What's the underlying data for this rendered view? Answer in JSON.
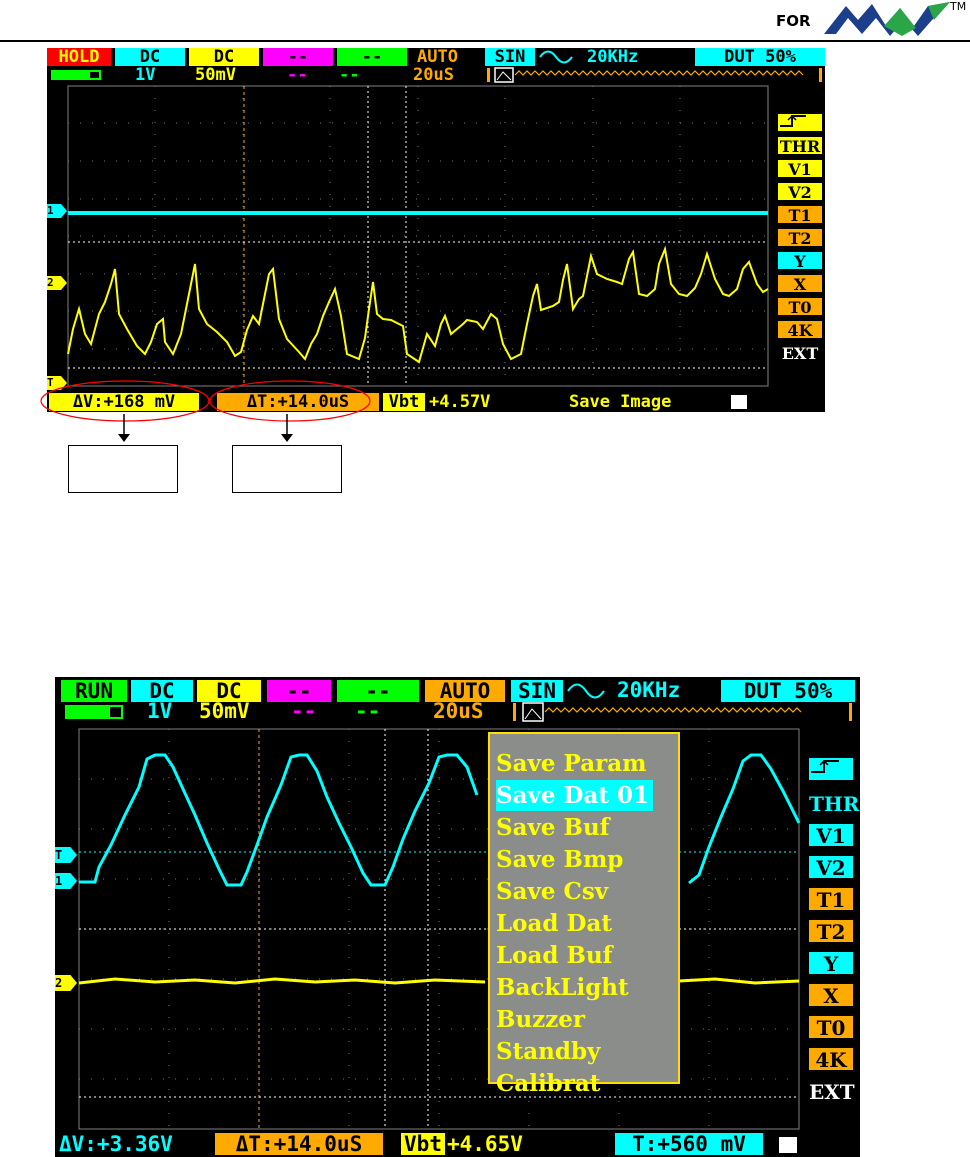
{
  "brand": {
    "for_label": "FOR",
    "tm": "TM"
  },
  "screen1": {
    "status": {
      "mode": "HOLD",
      "ch1_coupling": "DC",
      "ch2_coupling": "DC",
      "ch3": "--",
      "ch4": "--",
      "trigger_mode": "AUTO",
      "wave": "SIN",
      "freq": "20KHz",
      "duty": "DUT 50%"
    },
    "row2": {
      "ch1_scale": "1V",
      "ch2_scale": "50mV",
      "ch3_scale": "--",
      "ch4_scale": "--",
      "timebase": "20uS"
    },
    "side_menu": [
      "THR",
      "V1",
      "V2",
      "T1",
      "T2",
      "Y",
      "X",
      "T0",
      "4K",
      "EXT"
    ],
    "bottom": {
      "dv": "ΔV:+168 mV",
      "dt": "ΔT:+14.0uS",
      "vbt_label": "Vbt",
      "vbt": "+4.57V",
      "message": "Save Image"
    },
    "markers": {
      "ch1": "1",
      "ch2": "2",
      "trig": "T"
    }
  },
  "screen2": {
    "status": {
      "mode": "RUN",
      "ch1_coupling": "DC",
      "ch2_coupling": "DC",
      "ch3": "--",
      "ch4": "--",
      "trigger_mode": "AUTO",
      "wave": "SIN",
      "freq": "20KHz",
      "duty": "DUT 50%"
    },
    "row2": {
      "ch1_scale": "1V",
      "ch2_scale": "50mV",
      "ch3_scale": "--",
      "ch4_scale": "--",
      "timebase": "20uS"
    },
    "side_menu": [
      "THR",
      "V1",
      "V2",
      "T1",
      "T2",
      "Y",
      "X",
      "T0",
      "4K",
      "EXT"
    ],
    "popup_menu": [
      "Save Param",
      "Save Dat 01",
      "Save Buf",
      "Save Bmp",
      "Save Csv",
      "Load Dat",
      "Load Buf",
      "BackLight",
      "Buzzer",
      "Standby",
      "Calibrat"
    ],
    "selected_index": 1,
    "bottom": {
      "dv": "ΔV:+3.36V",
      "dt": "ΔT:+14.0uS",
      "vbt_label": "Vbt",
      "vbt": "+4.65V",
      "t": "T:+560 mV"
    },
    "markers": {
      "ch1": "1",
      "ch2": "2",
      "trig": "T"
    }
  }
}
